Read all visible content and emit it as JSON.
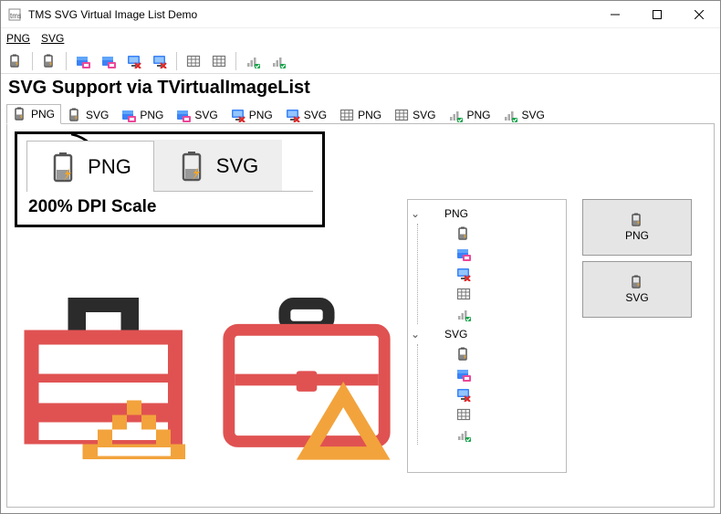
{
  "window": {
    "title": "TMS SVG Virtual Image List Demo"
  },
  "menubar": {
    "items": [
      "PNG",
      "SVG"
    ]
  },
  "heading": "SVG Support via TVirtualImageList",
  "tabs": {
    "items": [
      {
        "icon": "battery",
        "label": "PNG",
        "active": true
      },
      {
        "icon": "battery",
        "label": "SVG"
      },
      {
        "icon": "save-pink",
        "label": "PNG"
      },
      {
        "icon": "save-pink",
        "label": "SVG"
      },
      {
        "icon": "monitor-x",
        "label": "PNG"
      },
      {
        "icon": "monitor-x",
        "label": "SVG"
      },
      {
        "icon": "grid",
        "label": "PNG"
      },
      {
        "icon": "grid",
        "label": "SVG"
      },
      {
        "icon": "bars",
        "label": "PNG"
      },
      {
        "icon": "bars",
        "label": "SVG"
      }
    ]
  },
  "boxed": {
    "tabs": [
      {
        "label": "PNG",
        "active": true
      },
      {
        "label": "SVG",
        "active": false
      }
    ],
    "dpi_label": "200% DPI Scale"
  },
  "tree": {
    "nodes": [
      {
        "label": "PNG",
        "expanded": true,
        "children": [
          "battery",
          "save-pink",
          "monitor-x",
          "grid",
          "bars"
        ]
      },
      {
        "label": "SVG",
        "expanded": true,
        "children": [
          "battery",
          "save-pink",
          "monitor-x",
          "grid",
          "bars"
        ]
      }
    ]
  },
  "buttons": {
    "items": [
      {
        "label": "PNG"
      },
      {
        "label": "SVG"
      }
    ]
  },
  "icons": {
    "battery": "battery-icon",
    "save-pink": "save-pink-icon",
    "monitor-x": "monitor-x-icon",
    "grid": "grid-icon",
    "bars": "bars-icon"
  }
}
